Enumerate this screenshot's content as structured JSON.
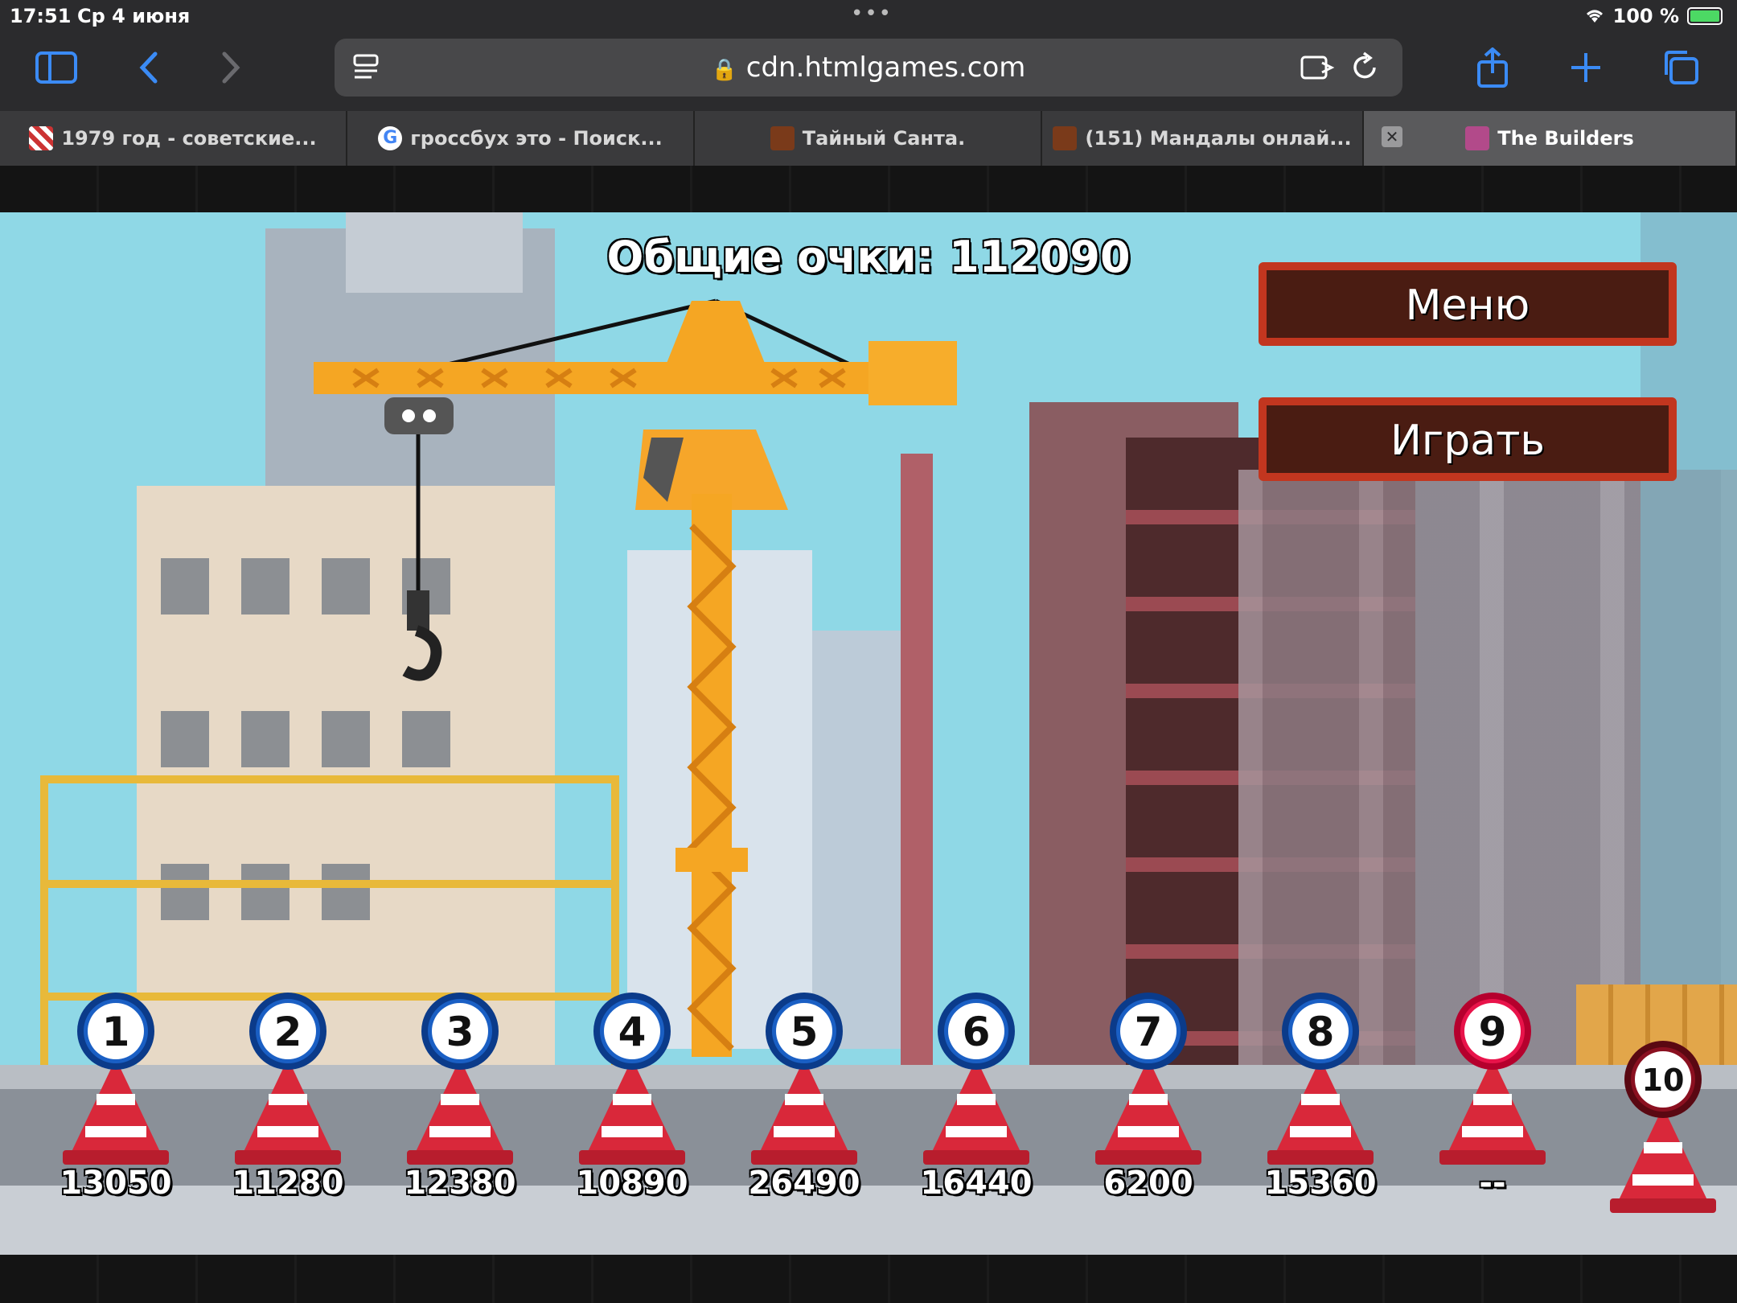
{
  "status_bar": {
    "time": "17:51",
    "date": "Ср 4 июня",
    "battery": "100 %"
  },
  "browser": {
    "url": "cdn.htmlgames.com"
  },
  "tabs": [
    {
      "label": "1979 год - советские..."
    },
    {
      "label": "гроссбух это - Поиск..."
    },
    {
      "label": "Тайный Санта."
    },
    {
      "label": "(151) Мандалы онлай..."
    },
    {
      "label": "The Builders"
    }
  ],
  "game": {
    "total_score_label": "Общие очки: 112090",
    "menu_button": "Меню",
    "play_button": "Играть",
    "levels": [
      {
        "number": "1",
        "score": "13050",
        "state": "done"
      },
      {
        "number": "2",
        "score": "11280",
        "state": "done"
      },
      {
        "number": "3",
        "score": "12380",
        "state": "done"
      },
      {
        "number": "4",
        "score": "10890",
        "state": "done"
      },
      {
        "number": "5",
        "score": "26490",
        "state": "done"
      },
      {
        "number": "6",
        "score": "16440",
        "state": "done"
      },
      {
        "number": "7",
        "score": "6200",
        "state": "done"
      },
      {
        "number": "8",
        "score": "15360",
        "state": "done"
      },
      {
        "number": "9",
        "score": "--",
        "state": "current"
      },
      {
        "number": "10",
        "score": "",
        "state": "locked"
      }
    ]
  },
  "colors": {
    "sky": "#8fd8e6",
    "crane": "#f5a623",
    "sign_border": "#c2361f",
    "sign_fill": "#4a1c12",
    "badge_blue": "#1a5fc4",
    "badge_red": "#e8134a"
  }
}
